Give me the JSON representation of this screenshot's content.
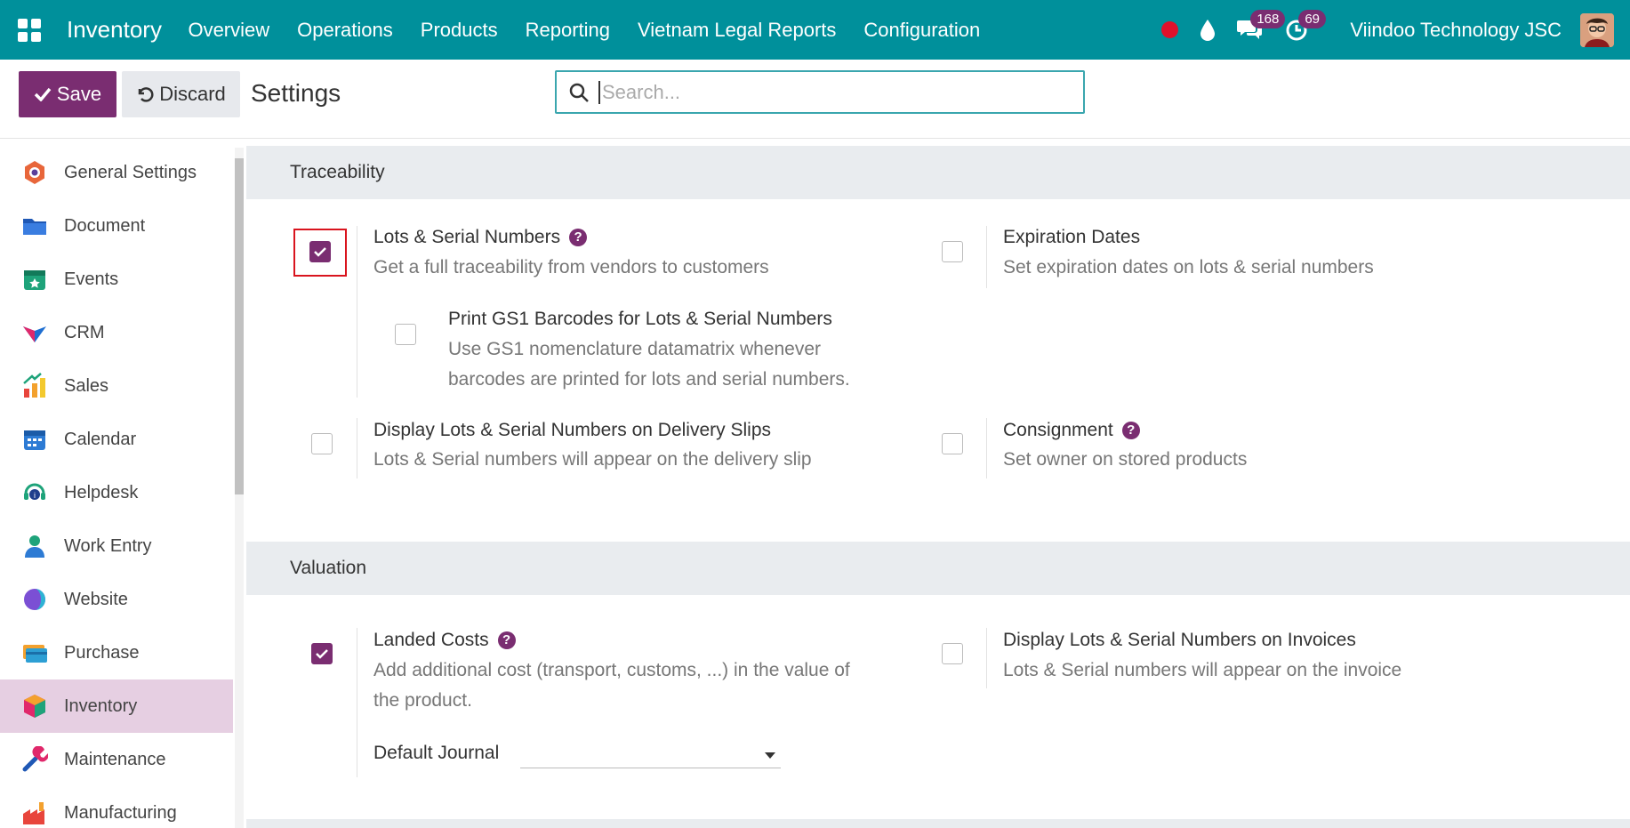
{
  "navbar": {
    "app_name": "Inventory",
    "menu": [
      "Overview",
      "Operations",
      "Products",
      "Reporting",
      "Vietnam Legal Reports",
      "Configuration"
    ],
    "messages_count": "168",
    "activities_count": "69",
    "company": "Viindoo Technology JSC"
  },
  "control": {
    "save_label": "Save",
    "discard_label": "Discard",
    "title": "Settings",
    "search_placeholder": "Search..."
  },
  "sidebar": {
    "items": [
      {
        "label": "General Settings",
        "icon": "general-settings-icon"
      },
      {
        "label": "Document",
        "icon": "folder-icon"
      },
      {
        "label": "Events",
        "icon": "calendar-star-icon"
      },
      {
        "label": "CRM",
        "icon": "crm-icon"
      },
      {
        "label": "Sales",
        "icon": "sales-chart-icon"
      },
      {
        "label": "Calendar",
        "icon": "calendar-icon"
      },
      {
        "label": "Helpdesk",
        "icon": "headset-icon"
      },
      {
        "label": "Work Entry",
        "icon": "person-icon"
      },
      {
        "label": "Website",
        "icon": "globe-icon"
      },
      {
        "label": "Purchase",
        "icon": "credit-card-icon"
      },
      {
        "label": "Inventory",
        "icon": "box-icon"
      },
      {
        "label": "Maintenance",
        "icon": "wrench-icon"
      },
      {
        "label": "Manufacturing",
        "icon": "factory-icon"
      }
    ],
    "active": "Inventory"
  },
  "traceability": {
    "title": "Traceability",
    "lots": {
      "title": "Lots & Serial Numbers",
      "desc": "Get a full traceability from vendors to customers",
      "checked": true
    },
    "gs1": {
      "title": "Print GS1 Barcodes for Lots & Serial Numbers",
      "desc1": "Use GS1 nomenclature datamatrix whenever",
      "desc2": "barcodes are printed for lots and serial numbers.",
      "checked": false
    },
    "expiration": {
      "title": "Expiration Dates",
      "desc": "Set expiration dates on lots & serial numbers",
      "checked": false
    },
    "delivery": {
      "title": "Display Lots & Serial Numbers on Delivery Slips",
      "desc": "Lots & Serial numbers will appear on the delivery slip",
      "checked": false
    },
    "consignment": {
      "title": "Consignment",
      "desc": "Set owner on stored products",
      "checked": false
    }
  },
  "valuation": {
    "title": "Valuation",
    "landed": {
      "title": "Landed Costs",
      "desc1": "Add additional cost (transport, customs, ...) in the value of",
      "desc2": "the product.",
      "checked": true,
      "journal_label": "Default Journal",
      "journal_value": ""
    },
    "invoices": {
      "title": "Display Lots & Serial Numbers on Invoices",
      "desc": "Lots & Serial numbers will appear on the invoice",
      "checked": false
    }
  },
  "colors": {
    "navbar": "#00909b",
    "primary": "#7a2d71",
    "highlight": "#d9141e"
  }
}
